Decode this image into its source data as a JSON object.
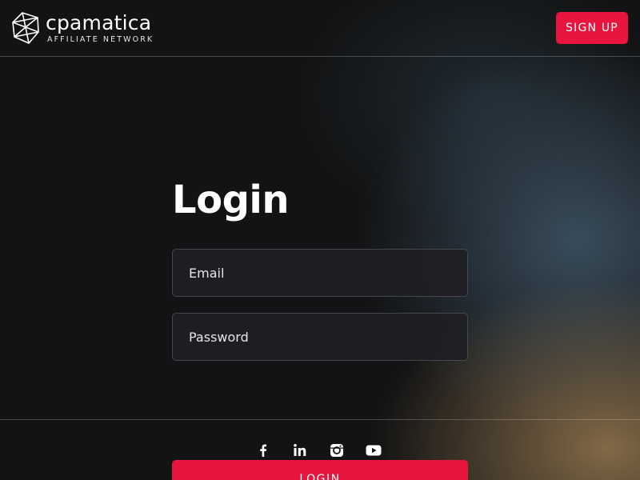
{
  "header": {
    "brand_name": "cpamatica",
    "brand_sub": "AFFILIATE NETWORK",
    "logo_icon": "geometric-polyhedron-logo",
    "signup_label": "SIGN UP"
  },
  "form": {
    "title": "Login",
    "email_placeholder": "Email",
    "password_placeholder": "Password",
    "login_label": "LOGIN"
  },
  "social": {
    "icons": [
      "facebook-icon",
      "linkedin-icon",
      "instagram-icon",
      "youtube-icon"
    ]
  },
  "colors": {
    "accent": "#e8163f",
    "background": "#121314",
    "field_background": "#1e2024"
  }
}
